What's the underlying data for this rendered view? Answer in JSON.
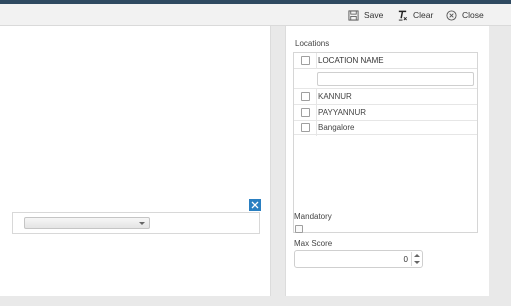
{
  "toolbar": {
    "save_label": "Save",
    "clear_label": "Clear",
    "close_label": "Close"
  },
  "locations": {
    "title": "Locations",
    "column_header": "LOCATION NAME",
    "filter_value": "",
    "rows": [
      {
        "label": "KANNUR",
        "checked": false
      },
      {
        "label": "PAYYANNUR",
        "checked": false
      },
      {
        "label": "Bangalore",
        "checked": false
      }
    ]
  },
  "mandatory": {
    "label": "Mandatory",
    "checked": false
  },
  "max_score": {
    "label": "Max Score",
    "value": "0"
  },
  "dropdown": {
    "selected": ""
  },
  "colors": {
    "accent": "#2a7fc1",
    "topbar": "#2f4a61"
  },
  "icons": {
    "save": "save-icon",
    "clear": "clear-format-icon",
    "close": "close-circle-icon",
    "remove": "close-icon"
  }
}
